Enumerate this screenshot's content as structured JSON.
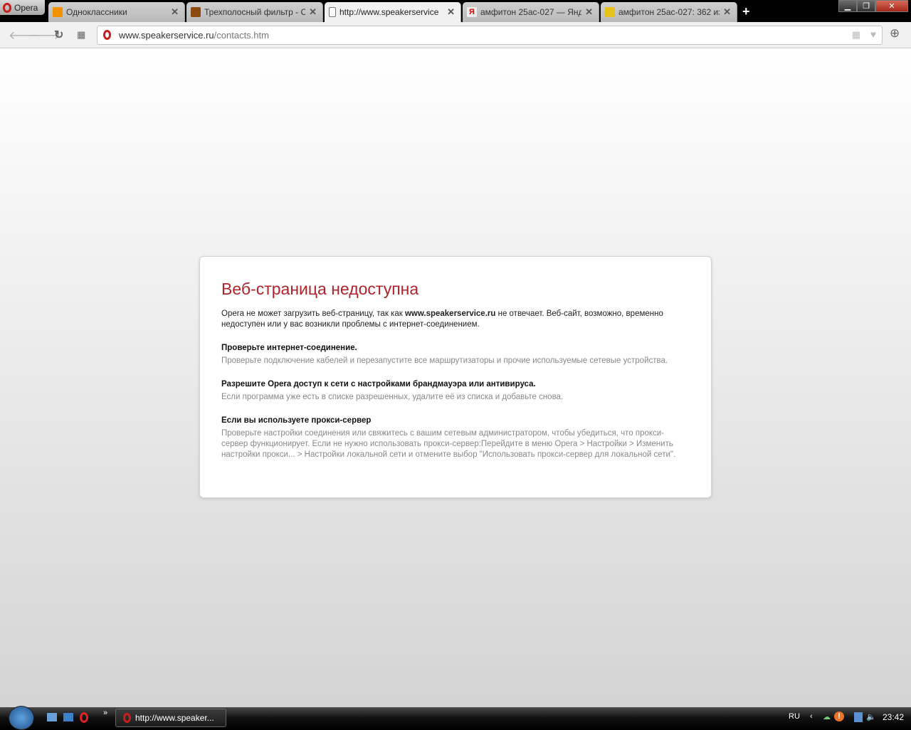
{
  "browser": {
    "menu_label": "Opera"
  },
  "tabs": [
    {
      "label": "Одноклассники",
      "fav_color": "#f39200"
    },
    {
      "label": "Трехполосный фильтр - С",
      "fav_color": "#8a4a10"
    },
    {
      "label": "http://www.speakerservice",
      "fav_color": "#dddddd"
    },
    {
      "label": "амфитон 25ас-027 — Янд",
      "fav_color": "#e8e8e8"
    },
    {
      "label": "амфитон 25ас-027: 362 из",
      "fav_color": "#e6c21a"
    }
  ],
  "address": {
    "domain": "www.speakerservice.ru",
    "path": "/contacts.htm"
  },
  "error": {
    "title": "Веб-страница недоступна",
    "intro_a": "Opera не может загрузить веб-страницу, так как ",
    "intro_site": "www.speakerservice.ru",
    "intro_b": " не отвечает. Веб-сайт, возможно, временно недоступен или у вас возникли проблемы с интернет-соединением.",
    "sections": [
      {
        "heading": "Проверьте интернет-соединение.",
        "text": "Проверьте подключение кабелей и перезапустите все маршрутизаторы и прочие используемые сетевые устройства."
      },
      {
        "heading": "Разрешите Opera доступ к сети с настройками брандмауэра или антивируса.",
        "text": "Если программа уже есть в списке разрешенных, удалите её из списка и добавьте снова."
      },
      {
        "heading": "Если вы используете прокси-сервер",
        "text": "Проверьте настройки соединения или свяжитесь с вашим сетевым администратором, чтобы убедиться, что прокси-сервер функционирует. Если не нужно использовать прокси-сервер:Перейдите в меню Opera > Настройки > Изменить настройки прокси... > Настройки локальной сети и отмените выбор \"Использовать прокси-сервер для локальной сети\"."
      }
    ]
  },
  "taskbar": {
    "task_label": "http://www.speaker...",
    "lang": "RU",
    "clock": "23:42",
    "more": "»"
  }
}
